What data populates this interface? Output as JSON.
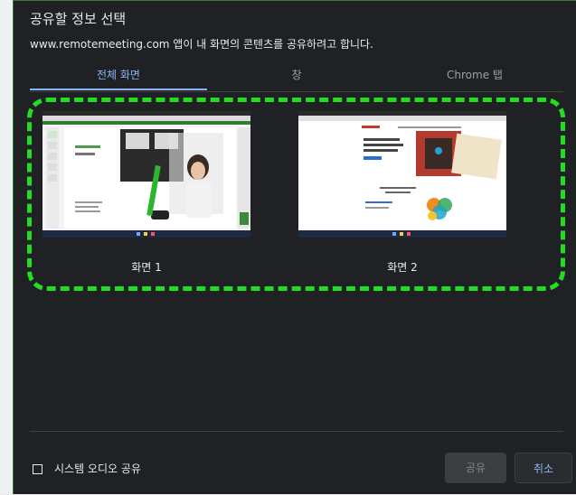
{
  "dialog": {
    "title": "공유할 정보 선택",
    "subtitle": "www.remotemeeting.com 앱이 내 화면의 콘텐츠를 공유하려고 합니다."
  },
  "tabs": [
    {
      "label": "전체 화면",
      "active": true
    },
    {
      "label": "창",
      "active": false
    },
    {
      "label": "Chrome 탭",
      "active": false
    }
  ],
  "screens": [
    {
      "label": "화면 1"
    },
    {
      "label": "화면 2"
    }
  ],
  "footer": {
    "audio_label": "시스템 오디오 공유",
    "audio_checked": false,
    "share_label": "공유",
    "cancel_label": "취소"
  },
  "colors": {
    "dialog_bg": "#202124",
    "accent": "#8ab4f8",
    "highlight": "#22dd22"
  }
}
